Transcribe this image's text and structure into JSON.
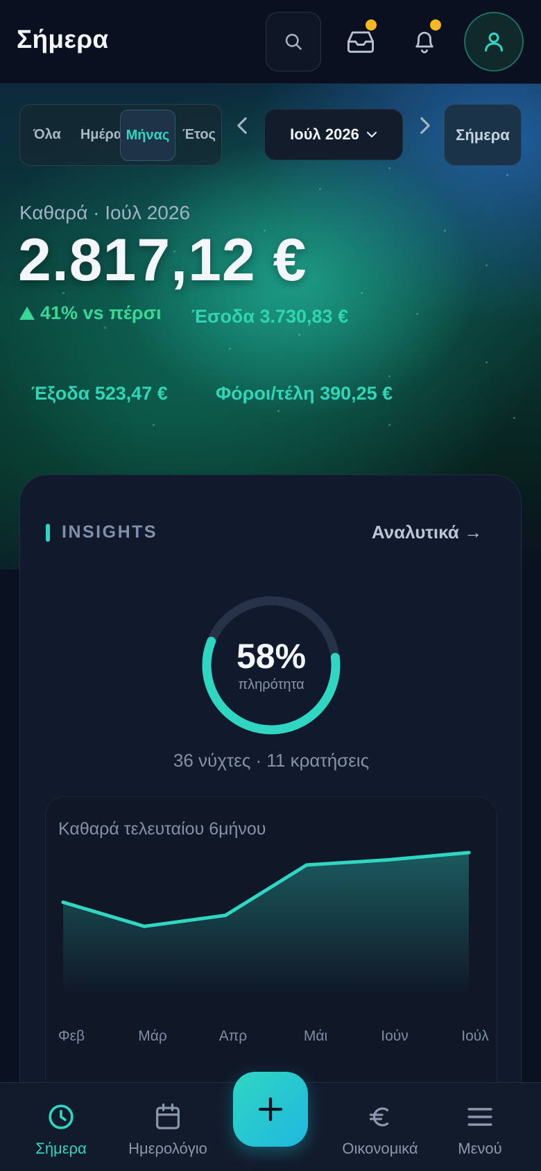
{
  "header": {
    "title": "Σήμερα"
  },
  "period_filter": {
    "segments": [
      "Όλα",
      "Ημέρα",
      "Μήνας",
      "Έτος"
    ],
    "selected": "Μήνας",
    "month_label": "Ιούλ 2026",
    "today_label": "Σήμερα"
  },
  "summary": {
    "net_label": "Καθαρά · Ιούλ 2026",
    "net_value": "2.817,12 €",
    "trend": "41% vs πέρσι",
    "income": "Έσοδα 3.730,83 €",
    "expenses": "Έξοδα 523,47 €",
    "taxes": "Φόροι/τέλη 390,25 €"
  },
  "insights": {
    "title": "INSIGHTS",
    "link": "Αναλυτικά →",
    "occupancy_percent": 58,
    "occupancy_value": "58%",
    "occupancy_label": "πληρότητα",
    "occupancy_summary": "36 νύχτες · 11 κρατήσεις"
  },
  "chart_data": {
    "type": "area",
    "title": "Καθαρά τελευταίου 6μήνου",
    "categories": [
      "Φεβ",
      "Μάρ",
      "Απρ",
      "Μάι",
      "Ιούν",
      "Ιούλ"
    ],
    "values": [
      0.46,
      0.13,
      0.28,
      0.97,
      1.04,
      1.14
    ],
    "ylim": [
      -0.76,
      1.14
    ],
    "grid": false,
    "color": "#2fd6c2"
  },
  "bottom_nav": {
    "items": [
      {
        "label": "Σήμερα",
        "icon": "clock-icon",
        "active": true
      },
      {
        "label": "Ημερολόγιο",
        "icon": "calendar-icon",
        "active": false
      },
      {
        "label": "Οικονομικά",
        "icon": "euro-icon",
        "active": false
      },
      {
        "label": "Μενού",
        "icon": "menu-icon",
        "active": false
      }
    ],
    "fab_icon": "plus-icon"
  },
  "colors": {
    "accent": "#2fd6c2",
    "notification": "#f5b820",
    "positive": "#3ad896"
  }
}
